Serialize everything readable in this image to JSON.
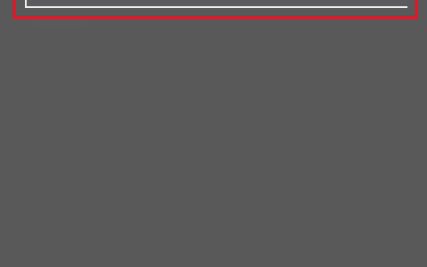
{
  "search": {
    "value": "",
    "placeholder": ""
  },
  "colors": {
    "background": "#595959",
    "highlight": "#d91b2c",
    "field_edge": "#efefef"
  }
}
